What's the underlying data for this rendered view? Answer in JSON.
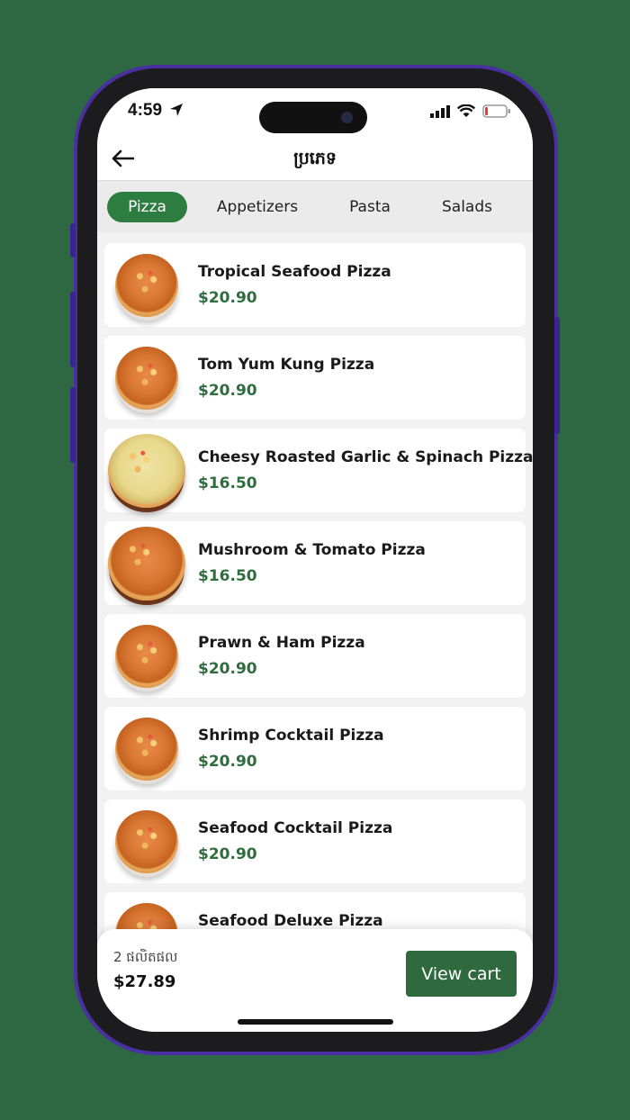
{
  "status_bar": {
    "time": "4:59"
  },
  "header": {
    "title": "ប្រភេទ"
  },
  "tabs": [
    {
      "label": "Pizza",
      "active": true
    },
    {
      "label": "Appetizers",
      "active": false
    },
    {
      "label": "Pasta",
      "active": false
    },
    {
      "label": "Salads",
      "active": false
    }
  ],
  "items": [
    {
      "name": "Tropical Seafood Pizza",
      "price": "$20.90"
    },
    {
      "name": "Tom Yum Kung Pizza",
      "price": "$20.90"
    },
    {
      "name": "Cheesy Roasted Garlic & Spinach Pizza",
      "price": "$16.50"
    },
    {
      "name": "Mushroom & Tomato Pizza",
      "price": "$16.50"
    },
    {
      "name": "Prawn & Ham Pizza",
      "price": "$20.90"
    },
    {
      "name": "Shrimp Cocktail Pizza",
      "price": "$20.90"
    },
    {
      "name": "Seafood Cocktail Pizza",
      "price": "$20.90"
    },
    {
      "name": "Seafood Deluxe Pizza",
      "price": ""
    }
  ],
  "cart": {
    "count_label": "2 ផលិតផល",
    "total": "$27.89",
    "button_label": "View cart"
  },
  "colors": {
    "background": "#2e6843",
    "accent": "#2e7d40",
    "price": "#2e6e3e"
  }
}
